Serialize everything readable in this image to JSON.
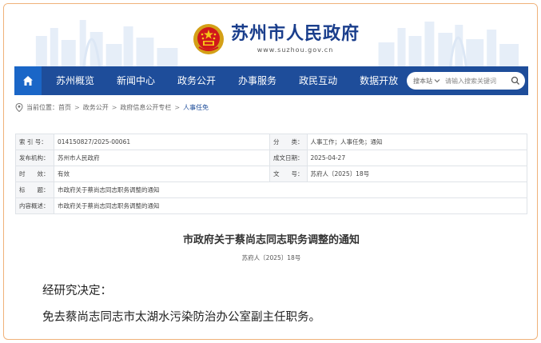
{
  "header": {
    "site_title": "苏州市人民政府",
    "site_url": "www.suzhou.gov.cn"
  },
  "nav": {
    "home_icon": "home-icon",
    "items": [
      {
        "label": "苏州概览"
      },
      {
        "label": "新闻中心"
      },
      {
        "label": "政务公开"
      },
      {
        "label": "办事服务"
      },
      {
        "label": "政民互动"
      },
      {
        "label": "数据开放"
      }
    ],
    "search": {
      "scope": "搜本站",
      "placeholder": "请输入搜索关键词",
      "icon": "search-icon"
    }
  },
  "breadcrumb": {
    "prefix": "当前位置：",
    "items": [
      "首页",
      "政务公开",
      "政府信息公开专栏",
      "人事任免"
    ]
  },
  "meta": {
    "index_label": "索 引 号：",
    "index_value": "014150827/2025-00061",
    "category_label": "分　　类：",
    "category_value": "人事工作；人事任免；通知",
    "issuer_label": "发布机构：",
    "issuer_value": "苏州市人民政府",
    "date_label": "成文日期：",
    "date_value": "2025-04-27",
    "validity_label": "时　　效：",
    "validity_value": "有效",
    "docno_label": "文　　号：",
    "docno_value": "苏府人〔2025〕18号",
    "title_label": "标　　题：",
    "title_value": "市政府关于蔡尚志同志职务调整的通知",
    "summary_label": "内容概述：",
    "summary_value": "市政府关于蔡尚志同志职务调整的通知"
  },
  "document": {
    "title": "市政府关于蔡尚志同志职务调整的通知",
    "number": "苏府人〔2025〕18号",
    "paragraphs": [
      "经研究决定：",
      "免去蔡尚志同志市太湖水污染防治办公室副主任职务。"
    ]
  },
  "colors": {
    "nav_bg": "#1e4d9a",
    "nav_home_bg": "#1a66c7",
    "title_blue": "#1a3e8c",
    "frame_border": "#f0b27a"
  }
}
